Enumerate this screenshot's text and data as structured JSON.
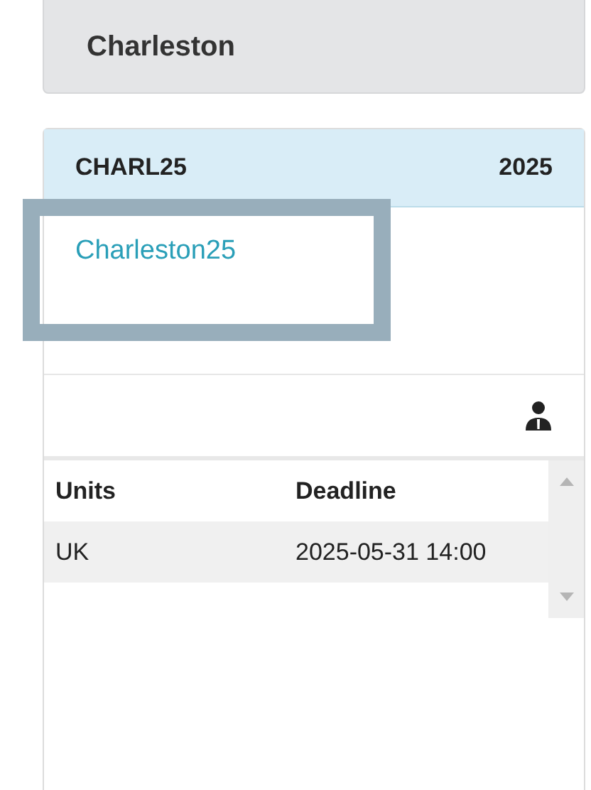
{
  "header": {
    "title": "Charleston"
  },
  "card": {
    "code": "CHARL25",
    "year": "2025",
    "link": "Charleston25",
    "table": {
      "columns": [
        "Units",
        "Deadline"
      ],
      "rows": [
        [
          "UK",
          "2025-05-31 14:00"
        ]
      ]
    }
  }
}
